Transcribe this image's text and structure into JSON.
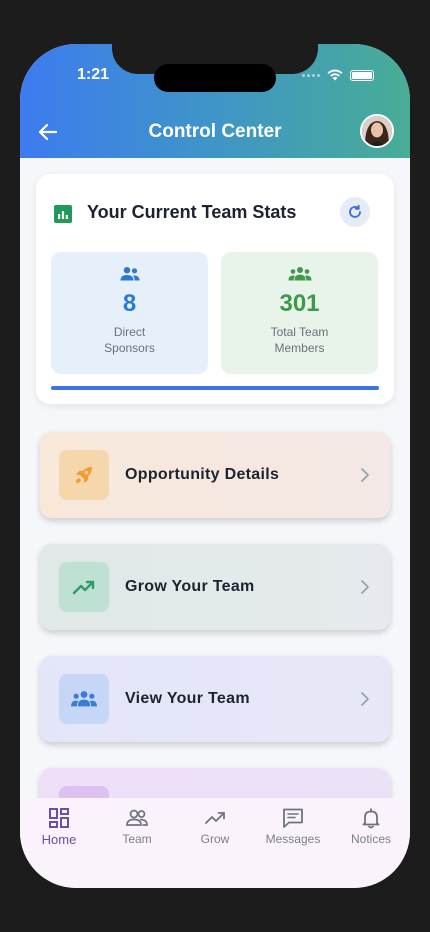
{
  "status_bar": {
    "time": "1:21"
  },
  "header": {
    "title": "Control Center"
  },
  "stats": {
    "title": "Your Current Team Stats",
    "direct_sponsors": {
      "value": "8",
      "label_line1": "Direct",
      "label_line2": "Sponsors"
    },
    "total_members": {
      "value": "301",
      "label_line1": "Total Team",
      "label_line2": "Members"
    }
  },
  "actions": [
    {
      "label": "Opportunity Details",
      "icon": "rocket-icon",
      "color": "#f5a43a"
    },
    {
      "label": "Grow Your Team",
      "icon": "trending-up-icon",
      "color": "#2e9b6d"
    },
    {
      "label": "View Your Team",
      "icon": "group-icon",
      "color": "#3a7bd5"
    },
    {
      "label": "",
      "icon": "partially-hidden-icon",
      "color": "#c8a3ee"
    }
  ],
  "nav": {
    "home": "Home",
    "team": "Team",
    "grow": "Grow",
    "messages": "Messages",
    "notices": "Notices"
  },
  "colors": {
    "accent": "#3b74e3",
    "active_nav": "#6a4ea9"
  }
}
